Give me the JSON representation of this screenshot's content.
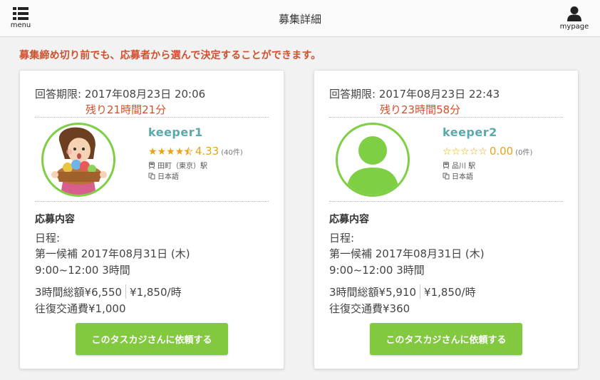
{
  "header": {
    "title": "募集詳細",
    "menu_label": "menu",
    "mypage_label": "mypage"
  },
  "notice": "募集締め切り前でも、応募者から選んで決定することができます。",
  "colors": {
    "accent_green": "#82c93f",
    "alert_red": "#d0502e",
    "keeper_teal": "#5aa9ad",
    "star_gold": "#e8a317"
  },
  "cards": [
    {
      "deadline": "回答期限: 2017年08月23日 20:06",
      "remaining": "残り21時間21分",
      "keeper_name": "keeper1",
      "rating": 4.33,
      "rating_text": "4.33",
      "review_count": "(40件)",
      "station": "田町（東京）駅",
      "language": "日本語",
      "avatar_icon": "housekeeper-illustration",
      "section_title": "応募内容",
      "schedule_label": "日程:",
      "candidate": "第一候補 2017年08月31日 (木)",
      "timeslot": "9:00~12:00 3時間",
      "total_price": "3時間総額¥6,550",
      "hourly_price": "¥1,850/時",
      "transport": "往復交通費¥1,000",
      "button_label": "このタスカジさんに依頼する"
    },
    {
      "deadline": "回答期限: 2017年08月23日 22:43",
      "remaining": "残り23時間58分",
      "keeper_name": "keeper2",
      "rating": 0.0,
      "rating_text": "0.00",
      "review_count": "(0件)",
      "station": "品川 駅",
      "language": "日本語",
      "avatar_icon": "default-user-silhouette",
      "section_title": "応募内容",
      "schedule_label": "日程:",
      "candidate": "第一候補 2017年08月31日 (木)",
      "timeslot": "9:00~12:00 3時間",
      "total_price": "3時間総額¥5,910",
      "hourly_price": "¥1,850/時",
      "transport": "往復交通費¥360",
      "button_label": "このタスカジさんに依頼する"
    }
  ]
}
